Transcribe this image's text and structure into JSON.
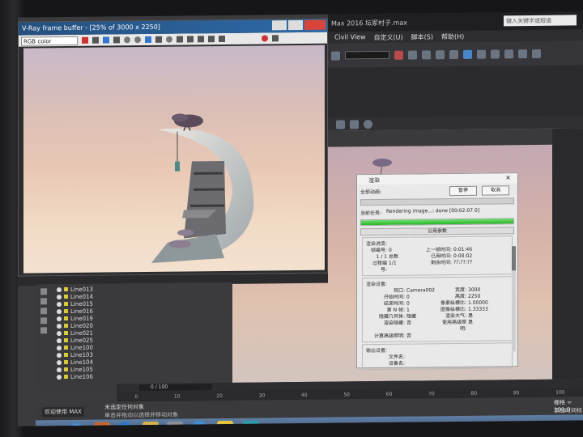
{
  "vfb": {
    "title": "V-Ray frame buffer - [25% of 3000 x 2250]",
    "channel": "RGB color"
  },
  "max": {
    "title": "Max 2016    坛冢村子.max",
    "search_placeholder": "键入关键字或短语",
    "menu": [
      "Civil View",
      "自定义(U)",
      "脚本(S)",
      "帮助(H)"
    ]
  },
  "layers": [
    "Line013",
    "Line014",
    "Line015",
    "Line016",
    "Line019",
    "Line020",
    "Line021",
    "Line025",
    "Line100",
    "Line103",
    "Line104",
    "Line105",
    "Line106"
  ],
  "render_dialog": {
    "title": "渲染",
    "pause": "暂停",
    "cancel": "取消",
    "total_label": "全部动画:",
    "current_task_label": "当前任务:",
    "current_task": "Rendering image...: done [00:02:07.0]",
    "progress": 1.0,
    "tab": "公用参数",
    "render_progress": {
      "title": "渲染进度:",
      "frame_label": "帧编号:",
      "frame": "0",
      "last_frame_time_label": "上一帧时间:",
      "last_frame_time": "0:01:46",
      "done_of": "1 / 1",
      "total": "总数",
      "elapsed_label": "已用时间:",
      "elapsed": "0:00:02",
      "remaining_label": "剩余时间:",
      "remaining": "??:??:??",
      "pass_label": "过程编号:",
      "pass": "1/1"
    },
    "render_settings": {
      "title": "渲染设置:",
      "viewport_label": "视口:",
      "viewport": "Camera002",
      "width_label": "宽度:",
      "width": "3000",
      "start_label": "开始时间:",
      "start": "0",
      "height_label": "高度:",
      "height": "2250",
      "end_label": "结束时间:",
      "end": "0",
      "pixel_aspect_label": "像素纵横比:",
      "pixel_aspect": "1.00000",
      "nth_label": "第 N 帧:",
      "nth": "1",
      "image_aspect_label": "图像纵横比:",
      "image_aspect": "1.33333",
      "hidden_geo_label": "隐藏几何体:",
      "hidden_geo": "隐藏",
      "render_atmo_label": "渲染大气:",
      "render_atmo": "是",
      "render_hidden_label": "渲染隐藏:",
      "render_hidden": "否",
      "use_adv_label": "使用高级照明:",
      "use_adv": "是",
      "compute_adv_label": "计算高级照明:",
      "compute_adv": "否"
    },
    "output": {
      "title": "输出设置:",
      "file_label": "文件名:",
      "device_label": "设备名:"
    }
  },
  "timeline": {
    "frame_counter": "0 / 100",
    "ticks": [
      "0",
      "10",
      "20",
      "30",
      "40",
      "50",
      "60",
      "70",
      "80",
      "90",
      "100"
    ]
  },
  "status": {
    "maxscript": "欢迎使用 MAX",
    "line1": "未选定任何对象",
    "line2": "单击并拖动以选择并移动对象",
    "coord": "栅格 = 100.0",
    "time": "添加时间标记"
  },
  "colors": {
    "progress_green": "#28b428",
    "vfb_title": "#2f6aa8",
    "close_red": "#d9453b"
  }
}
